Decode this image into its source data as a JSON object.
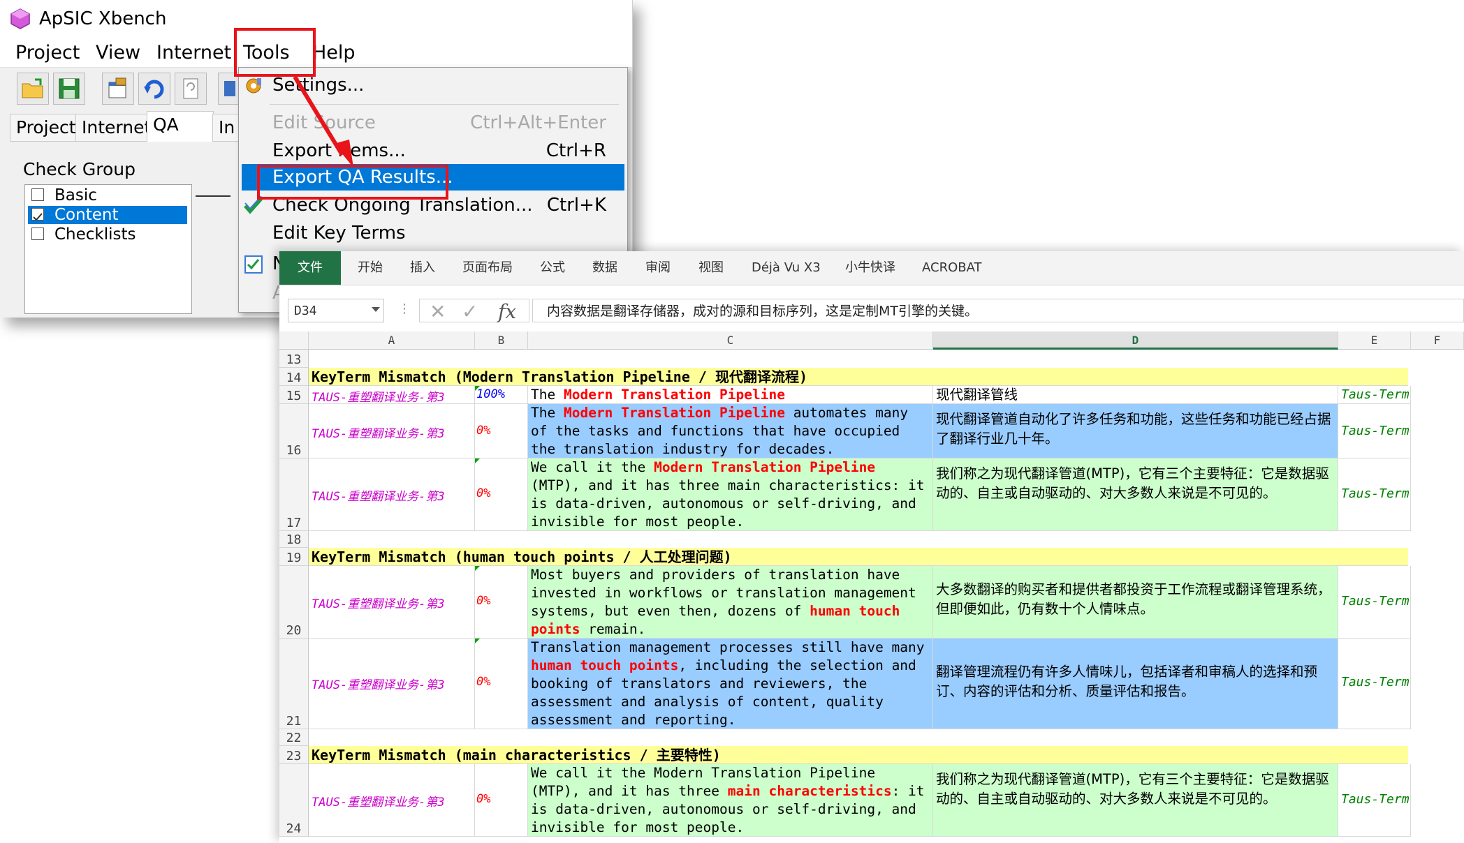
{
  "xbench": {
    "title": "ApSIC Xbench",
    "menu": [
      "Project",
      "View",
      "Internet",
      "Tools",
      "Help"
    ],
    "tabs": [
      "Project",
      "Internet",
      "QA",
      "In"
    ],
    "check_group_label": "Check Group",
    "check_items": [
      {
        "label": "Basic",
        "checked": false,
        "selected": false
      },
      {
        "label": "Content",
        "checked": true,
        "selected": true
      },
      {
        "label": "Checklists",
        "checked": false,
        "selected": false
      }
    ],
    "tools_menu": {
      "settings": "Settings...",
      "edit_source": "Edit Source",
      "edit_source_shortcut": "Ctrl+Alt+Enter",
      "export_items": "Export Items...",
      "export_items_shortcut": "Ctrl+R",
      "export_qa": "Export QA Results...",
      "check_ongoing": "Check Ongoing Translation...",
      "check_ongoing_shortcut": "Ctrl+K",
      "edit_key_terms": "Edit Key Terms",
      "partial_n": "N",
      "partial_a": "A"
    },
    "accent": "#0078d7",
    "annotation_color": "#e8141a"
  },
  "excel": {
    "ribbon_tabs": [
      "文件",
      "开始",
      "插入",
      "页面布局",
      "公式",
      "数据",
      "审阅",
      "视图",
      "Déjà Vu X3",
      "小牛快译",
      "ACROBAT"
    ],
    "name_box": "D34",
    "formula_content": "内容数据是翻译存储器，成对的源和目标序列，这是定制MT引擎的关键。",
    "columns": [
      "A",
      "B",
      "C",
      "D",
      "E",
      "F"
    ],
    "selected_column": "D",
    "file_name": "TAUS-重塑翻译业务-第3",
    "term_file": "Taus-Term.txt",
    "rows": {
      "r13": "13",
      "r14": {
        "num": "14",
        "header_pre": "KeyTerm Mismatch (",
        "header_term": "Modern Translation Pipeline",
        "header_post": " / 现代翻译流程)"
      },
      "r15": {
        "num": "15",
        "pct": "100%",
        "src_pre": "The ",
        "src_term": "Modern Translation Pipeline",
        "tgt": "现代翻译管线"
      },
      "r16": {
        "num": "16",
        "pct": "0%",
        "src_pre": "The ",
        "src_term": "Modern Translation Pipeline",
        "src_post": " automates many of the tasks and functions that have occupied the translation industry for decades.",
        "tgt": "现代翻译管道自动化了许多任务和功能，这些任务和功能已经占据了翻译行业几十年。"
      },
      "r17": {
        "num": "17",
        "pct": "0%",
        "src_pre": "We call it the ",
        "src_term": "Modern Translation Pipeline",
        "src_post": " (MTP), and it has three main characteristics: it is data-driven, autonomous or self-driving, and invisible for most people.",
        "tgt": "我们称之为现代翻译管道(MTP)，它有三个主要特征：它是数据驱动的、自主或自动驱动的、对大多数人来说是不可见的。"
      },
      "r18": "18",
      "r19": {
        "num": "19",
        "header_pre": "KeyTerm Mismatch (",
        "header_term": "human touch points",
        "header_post": " / 人工处理问题)"
      },
      "r20": {
        "num": "20",
        "pct": "0%",
        "src_pre": "Most buyers and providers of translation have invested in workflows or translation management systems, but even then, dozens of ",
        "src_term": "human touch points",
        "src_post": " remain.",
        "tgt": "大多数翻译的购买者和提供者都投资于工作流程或翻译管理系统，但即便如此，仍有数十个人情味点。"
      },
      "r21": {
        "num": "21",
        "pct": "0%",
        "src_pre": "Translation management processes still have many ",
        "src_term": "human touch points",
        "src_post": ", including the selection and booking of translators and reviewers, the assessment and analysis of content, quality assessment and reporting.",
        "tgt": "翻译管理流程仍有许多人情味儿，包括译者和审稿人的选择和预订、内容的评估和分析、质量评估和报告。"
      },
      "r22": "22",
      "r23": {
        "num": "23",
        "header_pre": "KeyTerm Mismatch (",
        "header_term": "main characteristics",
        "header_post": " / 主要特性)"
      },
      "r24": {
        "num": "24",
        "pct": "0%",
        "src_pre": "We call it the Modern Translation Pipeline (MTP), and it has three ",
        "src_term": "main characteristics",
        "src_post": ": it is data-driven, autonomous or self-driving, and invisible for most people.",
        "tgt": "我们称之为现代翻译管道(MTP)，它有三个主要特征：它是数据驱动的、自主或自动驱动的、对大多数人来说是不可见的。"
      }
    },
    "colors": {
      "header_yellow": "#ffff99",
      "green_fill": "#ccffcc",
      "blue_fill": "#99ccff",
      "term_red": "#ff0000",
      "file_magenta": "#cc00cc",
      "excel_green": "#217346"
    }
  }
}
